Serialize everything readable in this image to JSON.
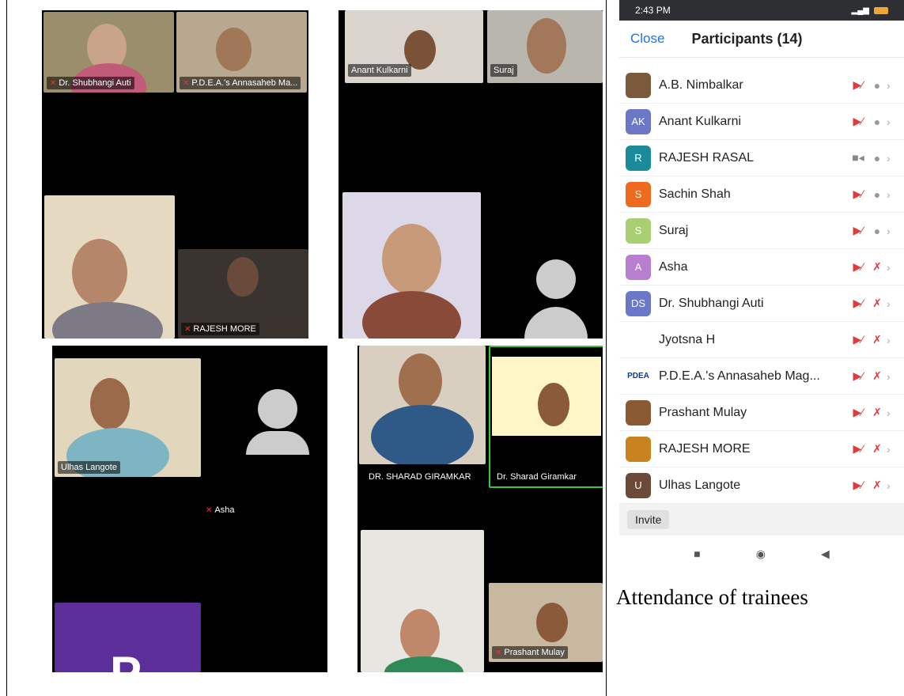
{
  "screenshots": {
    "top_left": {
      "tiles": [
        "Dr. Shubhangi Auti",
        "P.D.E.A.'s Annasaheb Ma...",
        "RAJESH MORE"
      ]
    },
    "top_right": {
      "tiles": [
        "Anant Kulkarni",
        "Suraj"
      ]
    },
    "bottom_left": {
      "tiles": [
        "Ulhas Langote",
        "Asha"
      ],
      "avatar_letter": "P"
    },
    "bottom_right": {
      "tiles": [
        "DR. SHARAD GIRAMKAR",
        "Dr. Sharad Giramkar",
        "Prashant Mulay"
      ]
    }
  },
  "phone": {
    "status_time": "2:43 PM",
    "close_label": "Close",
    "title": "Participants (14)",
    "participants": [
      {
        "name": "A.B. Nimbalkar",
        "initials": "",
        "color": "#7a5a3a",
        "video": "off",
        "mic": "on"
      },
      {
        "name": "Anant Kulkarni",
        "initials": "AK",
        "color": "#6b78c8",
        "video": "off",
        "mic": "on"
      },
      {
        "name": "RAJESH RASAL",
        "initials": "R",
        "color": "#1b8a99",
        "video": "on",
        "mic": "on"
      },
      {
        "name": "Sachin Shah",
        "initials": "S",
        "color": "#ee6a1e",
        "video": "off",
        "mic": "on"
      },
      {
        "name": "Suraj",
        "initials": "S",
        "color": "#a8cf72",
        "video": "off",
        "mic": "on"
      },
      {
        "name": "Asha",
        "initials": "A",
        "color": "#b87fd1",
        "video": "off",
        "mic": "off"
      },
      {
        "name": "Dr. Shubhangi Auti",
        "initials": "DS",
        "color": "#6b78c8",
        "video": "off",
        "mic": "off"
      },
      {
        "name": "Jyotsna H",
        "initials": "",
        "color": "#ffffff",
        "video": "off",
        "mic": "off"
      },
      {
        "name": "P.D.E.A.'s Annasaheb Mag...",
        "initials": "PDEA",
        "color": "#ffffff",
        "video": "off",
        "mic": "off"
      },
      {
        "name": "Prashant Mulay",
        "initials": "",
        "color": "#8a5a34",
        "video": "off",
        "mic": "off"
      },
      {
        "name": "RAJESH MORE",
        "initials": "",
        "color": "#c8821e",
        "video": "off",
        "mic": "off"
      },
      {
        "name": "Ulhas Langote",
        "initials": "U",
        "color": "#6b4a3a",
        "video": "off",
        "mic": "off"
      }
    ],
    "invite_label": "Invite"
  },
  "caption": "Attendance of trainees"
}
